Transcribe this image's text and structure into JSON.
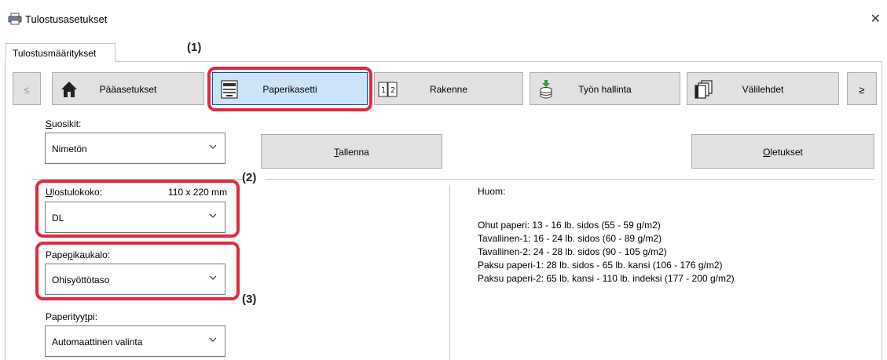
{
  "window": {
    "title": "Tulostusasetukset",
    "close_glyph": "✕"
  },
  "tabs": [
    {
      "label": "Tulostusmääritykset",
      "selected": true
    }
  ],
  "nav": {
    "prev_label": "≤",
    "next_label": "≥",
    "buttons": [
      {
        "label": "Pääasetukset",
        "icon": "home-icon"
      },
      {
        "label": "Paperikasetti",
        "icon": "paper-tray-icon",
        "selected": true
      },
      {
        "label": "Rakenne",
        "icon": "layout-icon"
      },
      {
        "label": "Työn hallinta",
        "icon": "job-storage-icon"
      },
      {
        "label": "Välilehdet",
        "icon": "tab-pages-icon"
      }
    ]
  },
  "favorites": {
    "label": "Suosikit:",
    "value": "Nimetön",
    "save_label": "Tallenna",
    "defaults_label": "Oletukset"
  },
  "output_size": {
    "label": "Ulostulokoko:",
    "dimension": "110 x 220 mm",
    "value": "DL"
  },
  "paper_tray": {
    "label": "Paperikaukalo:",
    "value": "Ohisyöttötaso"
  },
  "paper_type": {
    "label": "Paperityyppi:",
    "value": "Automaattinen valinta"
  },
  "notes": {
    "title": "Huom:",
    "lines": [
      "Ohut paperi: 13 - 16 lb. sidos (55 - 59 g/m2)",
      "Tavallinen-1: 16 - 24 lb. sidos (60 - 89 g/m2)",
      "Tavallinen-2: 24 - 28 lb. sidos (90 - 105 g/m2)",
      "Paksu paperi-1: 28 lb. sidos - 65 lb. kansi (106 - 176 g/m2)",
      "Paksu paperi-2: 65 lb. kansi - 110 lb. indeksi (177 - 200 g/m2)"
    ]
  },
  "annotations": {
    "one": "(1)",
    "two": "(2)",
    "three": "(3)",
    "color": "#e3283f"
  }
}
